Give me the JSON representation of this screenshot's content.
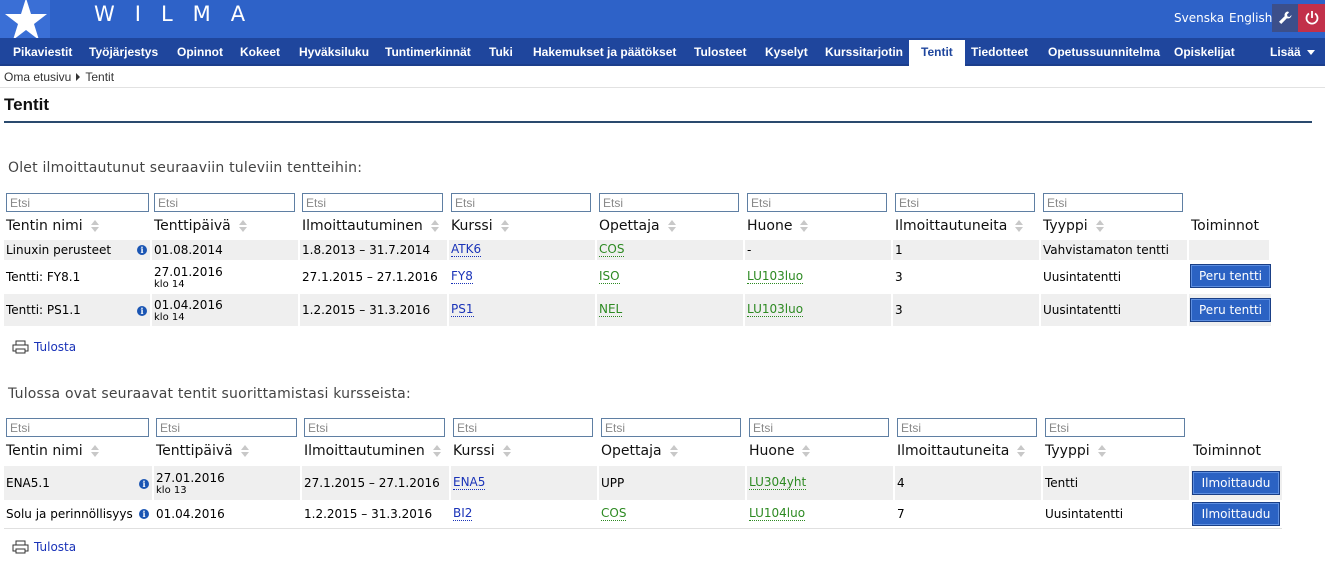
{
  "header": {
    "app_title": "WILMA",
    "lang_sv": "Svenska",
    "lang_en": "English",
    "icons": {
      "logo": "star-logo-icon",
      "settings": "wrench-icon",
      "logout": "power-icon"
    },
    "colors": {
      "topbar": "#2e62c8",
      "navbar": "#1f469d",
      "logout": "#c2304a"
    }
  },
  "nav": {
    "items": [
      "Pikaviestit",
      "Työjärjestys",
      "Opinnot",
      "Kokeet",
      "Hyväksiluku",
      "Tuntimerkinnät",
      "Tuki",
      "Hakemukset ja päätökset",
      "Tulosteet",
      "Kyselyt",
      "Kurssitarjotin",
      "Tentit",
      "Tiedotteet",
      "Opetussuunnitelma",
      "Opiskelijat"
    ],
    "active": "Tentit",
    "more": "Lisää"
  },
  "breadcrumb": {
    "home": "Oma etusivu",
    "current": "Tentit"
  },
  "page_title": "Tentit",
  "search_placeholder": "Etsi",
  "columns": [
    "Tentin nimi",
    "Tenttipäivä",
    "Ilmoittautuminen",
    "Kurssi",
    "Opettaja",
    "Huone",
    "Ilmoittautuneita",
    "Tyyppi",
    "Toiminnot"
  ],
  "registered": {
    "heading": "Olet ilmoittautunut seuraaviin tuleviin tentteihin:",
    "rows": [
      {
        "name": "Linuxin perusteet",
        "info": true,
        "date": "01.08.2014",
        "time": "",
        "enrollment": "1.8.2013 – 31.7.2014",
        "course": "ATK6",
        "teacher": "COS",
        "room": "-",
        "room_link": false,
        "count": "1",
        "type": "Vahvistamaton tentti",
        "action": ""
      },
      {
        "name": "Tentti: FY8.1",
        "info": false,
        "date": "27.01.2016",
        "time": "klo 14",
        "enrollment": "27.1.2015 – 27.1.2016",
        "course": "FY8",
        "teacher": "ISO",
        "room": "LU103luo",
        "room_link": true,
        "count": "3",
        "type": "Uusintatentti",
        "action": "Peru tentti"
      },
      {
        "name": "Tentti: PS1.1",
        "info": true,
        "date": "01.04.2016",
        "time": "klo 14",
        "enrollment": "1.2.2015 – 31.3.2016",
        "course": "PS1",
        "teacher": "NEL",
        "room": "LU103luo",
        "room_link": true,
        "count": "3",
        "type": "Uusintatentti",
        "action": "Peru tentti"
      }
    ],
    "print": "Tulosta"
  },
  "upcoming": {
    "heading": "Tulossa ovat seuraavat tentit suorittamistasi kursseista:",
    "rows": [
      {
        "name": "ENA5.1",
        "info": true,
        "date": "27.01.2016",
        "time": "klo 13",
        "enrollment": "27.1.2015 – 27.1.2016",
        "course": "ENA5",
        "teacher": "UPP",
        "teacher_link": false,
        "room": "LU304yht",
        "count": "4",
        "type": "Tentti",
        "action": "Ilmoittaudu"
      },
      {
        "name": "Solu ja perinnöllisyys",
        "info": true,
        "date": "01.04.2016",
        "time": "",
        "enrollment": "1.2.2015 – 31.3.2016",
        "course": "BI2",
        "teacher": "COS",
        "teacher_link": true,
        "room": "LU104luo",
        "count": "7",
        "type": "Uusintatentti",
        "action": "Ilmoittaudu"
      }
    ],
    "print": "Tulosta"
  }
}
